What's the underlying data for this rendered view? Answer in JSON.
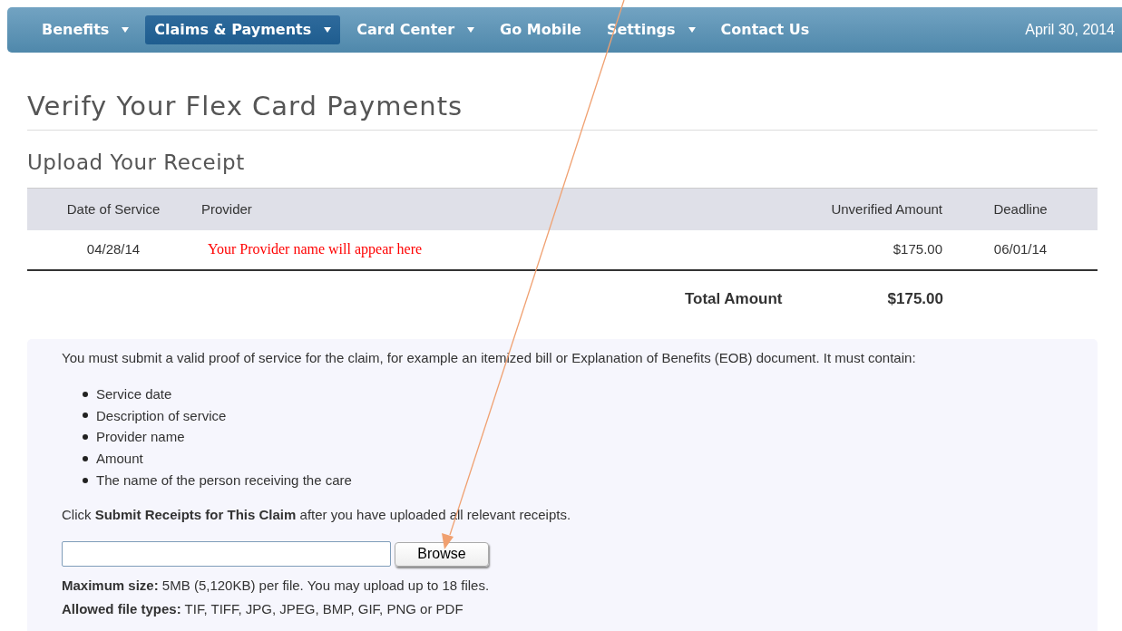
{
  "nav": {
    "items": [
      {
        "label": "Benefits",
        "caret": true,
        "selected": false
      },
      {
        "label": "Claims & Payments",
        "caret": true,
        "selected": true
      },
      {
        "label": "Card Center",
        "caret": true,
        "selected": false
      },
      {
        "label": "Go Mobile",
        "caret": false,
        "selected": false
      },
      {
        "label": "Settings",
        "caret": true,
        "selected": false
      },
      {
        "label": "Contact Us",
        "caret": false,
        "selected": false
      }
    ],
    "date": "April 30, 2014"
  },
  "title": "Verify Your Flex Card Payments",
  "subtitle": "Upload Your Receipt",
  "table": {
    "columns": [
      "Date of Service",
      "Provider",
      "Unverified Amount",
      "Deadline"
    ],
    "rows": [
      {
        "date": "04/28/14",
        "provider": "Your Provider name will appear here",
        "amount": "$175.00",
        "deadline": "06/01/14"
      }
    ],
    "total_label": "Total Amount",
    "total_value": "$175.00"
  },
  "info": {
    "intro": "You must submit a valid proof of service for the claim, for example an itemized bill or Explanation of Benefits (EOB) document. It must contain:",
    "requirements": [
      "Service date",
      "Description of service",
      "Provider name",
      "Amount",
      "The name of the person receiving the care"
    ],
    "instruction": "Click **Submit Receipts for This Claim** after you have uploaded all relevant receipts.",
    "browse_button": "Browse",
    "notes": [
      "**Maximum size:** 5MB (5,120KB) per file. You may upload up to 18 files.",
      "**Allowed file types:** TIF, TIFF, JPG, JPEG, BMP, GIF, PNG or PDF"
    ]
  }
}
